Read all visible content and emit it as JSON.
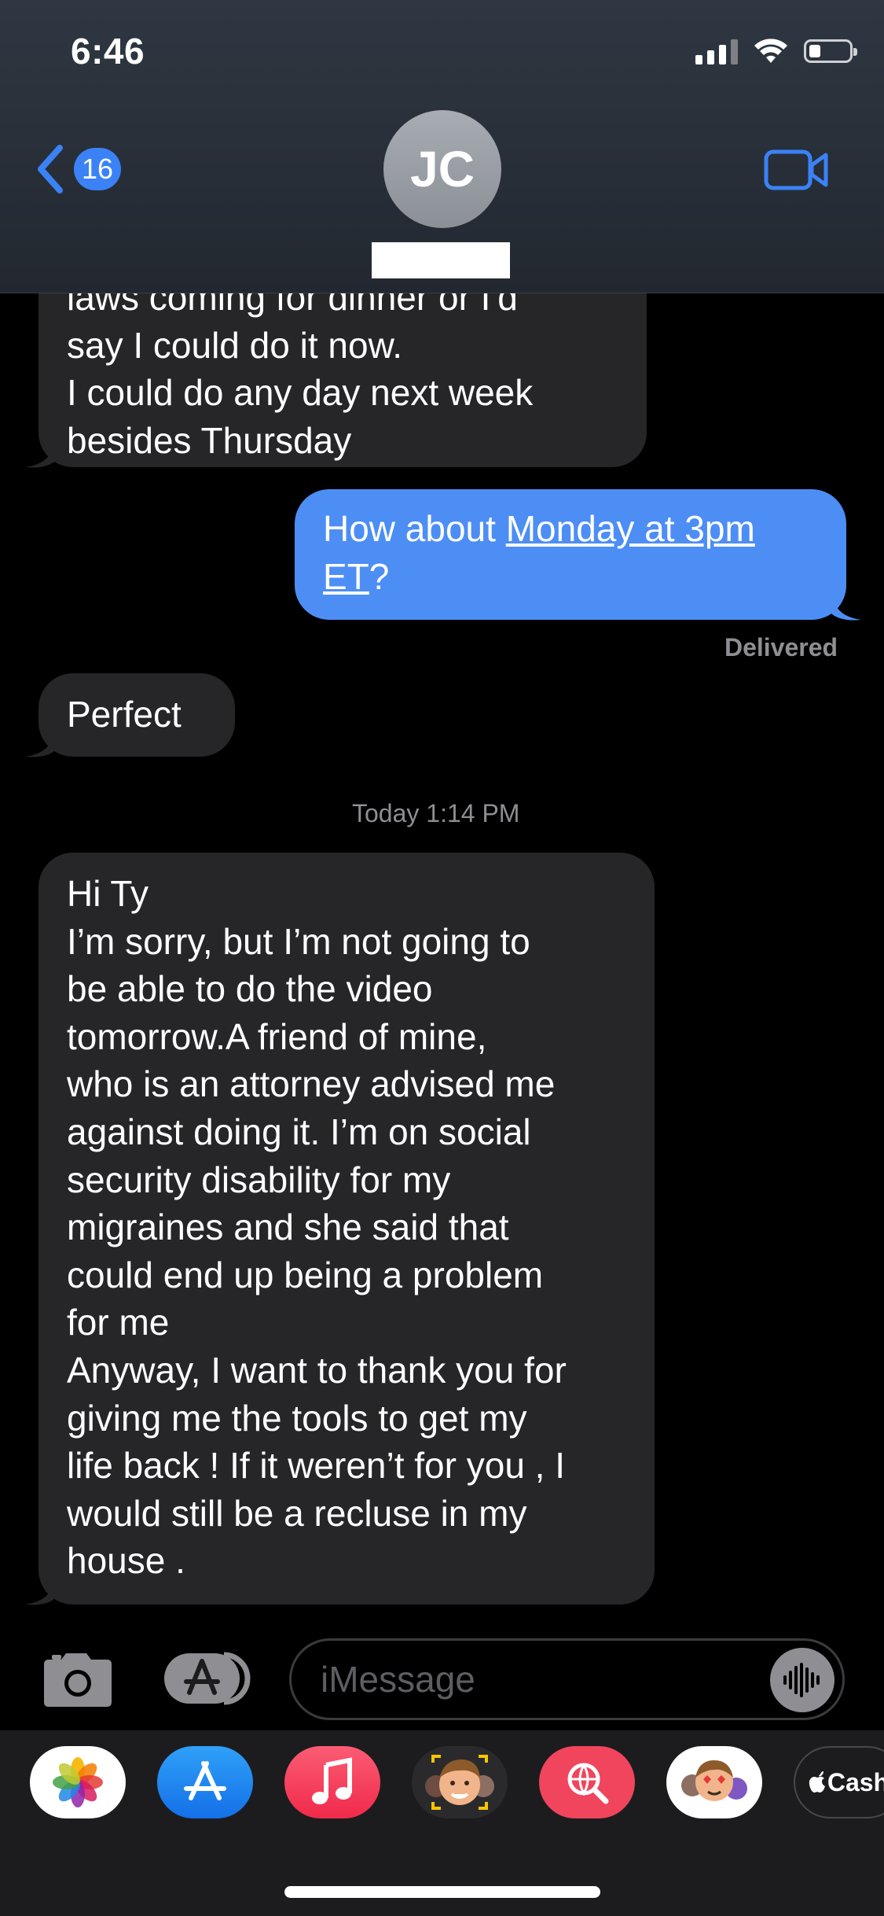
{
  "status_bar": {
    "time": "6:46"
  },
  "header": {
    "back_count": "16",
    "contact_initials": "JC"
  },
  "messages": {
    "m1": {
      "lines": [
        "laws coming for dinner or I'd",
        "say I could do it now.",
        "I could do any day next week",
        "besides Thursday"
      ]
    },
    "m2": {
      "pre": "How about ",
      "link1": "Monday at 3pm",
      "link2": "ET",
      "post": "?",
      "status": "Delivered"
    },
    "m3": {
      "text": "Perfect"
    },
    "timestamp": "Today 1:14 PM",
    "m4": {
      "lines": [
        "Hi Ty",
        "I’m sorry, but I’m not going to",
        "be able to do the video",
        "tomorrow.A friend of mine,",
        "who is an attorney advised me",
        "against doing it. I’m on social",
        "security disability for my",
        "migraines and she said that",
        "could end up being a problem",
        "for me",
        "Anyway, I want to thank you for",
        "giving me the tools to get my",
        "life back ! If it weren’t for you , I",
        "would still be a recluse in my",
        "house ."
      ]
    }
  },
  "input": {
    "placeholder": "iMessage"
  },
  "app_drawer": {
    "apps": [
      "photos-icon",
      "app-store-icon",
      "music-icon",
      "memoji-icon",
      "web-search-icon",
      "animoji-stickers-icon",
      "apple-cash-icon"
    ],
    "cash_label": "Cash"
  }
}
